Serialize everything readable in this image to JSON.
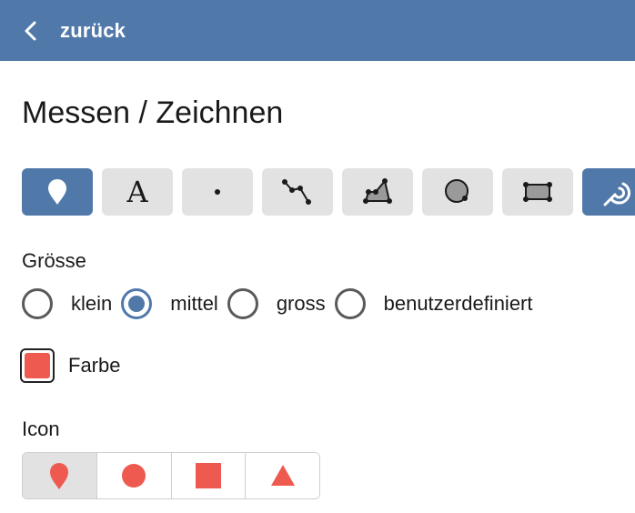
{
  "header": {
    "back_label": "zurück",
    "background": "#5079aa"
  },
  "page": {
    "title": "Messen / Zeichnen"
  },
  "tools": [
    {
      "name": "marker-icon",
      "active": true
    },
    {
      "name": "text-icon",
      "glyph": "A",
      "active": false
    },
    {
      "name": "point-icon",
      "active": false
    },
    {
      "name": "line-icon",
      "active": false
    },
    {
      "name": "polygon-icon",
      "active": false
    },
    {
      "name": "circle-icon",
      "active": false
    },
    {
      "name": "rectangle-icon",
      "active": false
    },
    {
      "name": "rotate-icon",
      "active": true
    }
  ],
  "size": {
    "label": "Grösse",
    "options": [
      "klein",
      "mittel",
      "gross",
      "benutzerdefiniert"
    ],
    "selected": "mittel"
  },
  "color": {
    "label": "Farbe",
    "value": "#ee5a4f",
    "checked": true
  },
  "icon": {
    "label": "Icon",
    "options": [
      "marker-icon",
      "circle-icon",
      "square-icon",
      "triangle-icon"
    ],
    "selected": "marker-icon",
    "color": "#ee5a4f"
  }
}
